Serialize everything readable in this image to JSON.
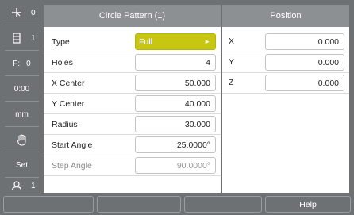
{
  "status_bar": {
    "items": [
      {
        "icon": "datum-icon",
        "value": "0"
      },
      {
        "icon": "tool-icon",
        "value": "1"
      },
      {
        "label": "F:",
        "value": "0"
      },
      {
        "text": "0:00"
      },
      {
        "text": "mm"
      },
      {
        "icon": "hand-icon"
      },
      {
        "text": "Set"
      },
      {
        "icon": "user-icon",
        "value": "1"
      }
    ]
  },
  "circle_pattern": {
    "title": "Circle Pattern (1)",
    "fields": [
      {
        "label": "Type",
        "value": "Full"
      },
      {
        "label": "Holes",
        "value": "4"
      },
      {
        "label": "X Center",
        "value": "50.000"
      },
      {
        "label": "Y Center",
        "value": "40.000"
      },
      {
        "label": "Radius",
        "value": "30.000"
      },
      {
        "label": "Start Angle",
        "value": "25.0000°"
      },
      {
        "label": "Step Angle",
        "value": "90.0000°"
      }
    ]
  },
  "position": {
    "title": "Position",
    "axes": [
      {
        "axis": "X",
        "value": "0.000"
      },
      {
        "axis": "Y",
        "value": "0.000"
      },
      {
        "axis": "Z",
        "value": "0.000"
      }
    ]
  },
  "softkeys": {
    "labels": [
      "",
      "",
      "",
      "",
      "Help"
    ]
  },
  "colors": {
    "chrome": "#6e7174",
    "header": "#8d9093",
    "select_highlight": "#c7c712"
  }
}
